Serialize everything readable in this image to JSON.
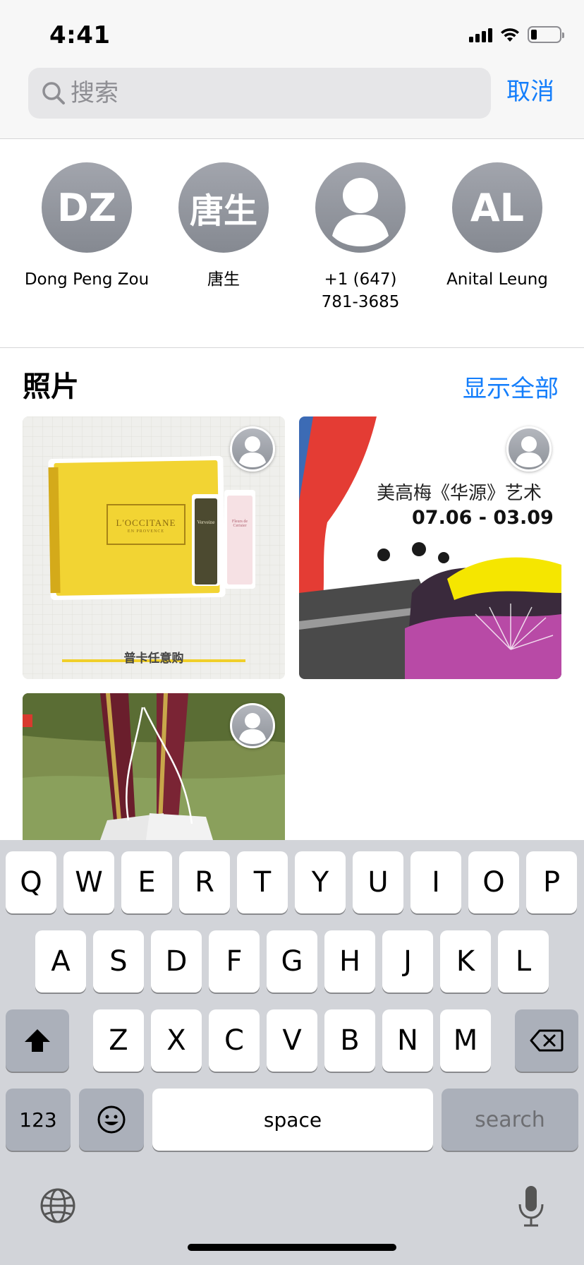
{
  "status_bar": {
    "time": "4:41",
    "battery_percent": 15
  },
  "search": {
    "placeholder": "搜索",
    "cancel_label": "取消"
  },
  "contacts": [
    {
      "initials": "DZ",
      "name": "Dong Peng Zou"
    },
    {
      "initials": "唐生",
      "name": "唐生"
    },
    {
      "initials": "",
      "name_line1": "+1 (647)",
      "name_line2": "781-3685",
      "icon": "person-silhouette-icon"
    },
    {
      "initials": "AL",
      "name": "Anital Leung"
    }
  ],
  "photos": {
    "title": "照片",
    "show_all": "显示全部",
    "items": [
      {
        "brand": "L'OCCITANE",
        "brand_sub": "EN PROVENCE",
        "tube1": "Verveine",
        "tube2": "Fleurs de Cerisier",
        "caption": "普卡任意购"
      },
      {
        "headline": "美高梅《华源》艺术",
        "dates": "07.06 - 03.09"
      },
      {
        "description": "person-tying-shoelaces"
      }
    ]
  },
  "keyboard": {
    "row1": [
      "Q",
      "W",
      "E",
      "R",
      "T",
      "Y",
      "U",
      "I",
      "O",
      "P"
    ],
    "row2": [
      "A",
      "S",
      "D",
      "F",
      "G",
      "H",
      "J",
      "K",
      "L"
    ],
    "row3": [
      "Z",
      "X",
      "C",
      "V",
      "B",
      "N",
      "M"
    ],
    "numbers_label": "123",
    "space_label": "space",
    "search_label": "search"
  },
  "colors": {
    "accent": "#147efb",
    "keyboard_bg": "#d2d4d9"
  }
}
